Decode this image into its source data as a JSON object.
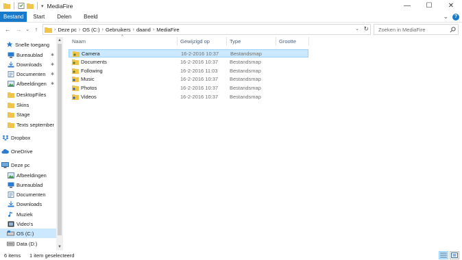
{
  "window": {
    "title": "MediaFire",
    "controls": {
      "minimize": "—",
      "maximize": "☐",
      "close": "✕"
    }
  },
  "ribbon": {
    "tabs": [
      "Bestand",
      "Start",
      "Delen",
      "Beeld"
    ],
    "expand_glyph": "⌄",
    "help_glyph": "?"
  },
  "nav": {
    "back": "←",
    "forward": "→",
    "recent": "⌄",
    "up": "↑",
    "breadcrumb": [
      "Deze pc",
      "OS (C:)",
      "Gebruikers",
      "daand",
      "MediaFire"
    ],
    "crumb_separator": "›",
    "dropdown": "⌄",
    "refresh": "↻"
  },
  "search": {
    "placeholder": "Zoeken in MediaFire"
  },
  "sidebar": {
    "quick_access": "Snelle toegang",
    "quick_items": [
      {
        "label": "Bureaublad",
        "icon": "desktop-icon",
        "pinned": true
      },
      {
        "label": "Downloads",
        "icon": "downloads-icon",
        "pinned": true
      },
      {
        "label": "Documenten",
        "icon": "documents-icon",
        "pinned": true
      },
      {
        "label": "Afbeeldingen",
        "icon": "pictures-icon",
        "pinned": true
      },
      {
        "label": "DesktopFiles",
        "icon": "folder-icon",
        "pinned": false
      },
      {
        "label": "Skins",
        "icon": "folder-icon",
        "pinned": false
      },
      {
        "label": "Stage",
        "icon": "folder-icon",
        "pinned": false
      },
      {
        "label": "Texts september",
        "icon": "folder-icon",
        "pinned": false
      }
    ],
    "dropbox": "Dropbox",
    "onedrive": "OneDrive",
    "this_pc": "Deze pc",
    "pc_items": [
      {
        "label": "Afbeeldingen",
        "icon": "pictures-icon"
      },
      {
        "label": "Bureaublad",
        "icon": "desktop-icon"
      },
      {
        "label": "Documenten",
        "icon": "documents-icon"
      },
      {
        "label": "Downloads",
        "icon": "downloads-icon"
      },
      {
        "label": "Muziek",
        "icon": "music-icon"
      },
      {
        "label": "Video's",
        "icon": "videos-icon"
      },
      {
        "label": "OS (C:)",
        "icon": "drive-icon",
        "selected": true
      },
      {
        "label": "Data (D:)",
        "icon": "drive-icon"
      }
    ],
    "pin_glyph": "✱"
  },
  "columns": {
    "name": "Naam",
    "date": "Gewijzigd op",
    "type": "Type",
    "size": "Grootte",
    "sort_glyph": "^"
  },
  "files": [
    {
      "name": "Camera",
      "date": "16-2-2016 10:37",
      "type": "Bestandsmap",
      "selected": true
    },
    {
      "name": "Documents",
      "date": "16-2-2016 10:37",
      "type": "Bestandsmap"
    },
    {
      "name": "Following",
      "date": "16-2-2016 11:03",
      "type": "Bestandsmap"
    },
    {
      "name": "Music",
      "date": "16-2-2016 10:37",
      "type": "Bestandsmap"
    },
    {
      "name": "Photos",
      "date": "16-2-2016 10:37",
      "type": "Bestandsmap"
    },
    {
      "name": "Videos",
      "date": "16-2-2016 10:37",
      "type": "Bestandsmap"
    }
  ],
  "status": {
    "count": "6 items",
    "selection": "1 item geselecteerd"
  },
  "colors": {
    "accent": "#1979ca",
    "selection": "#cce8ff",
    "folder": "#f0c44a"
  }
}
